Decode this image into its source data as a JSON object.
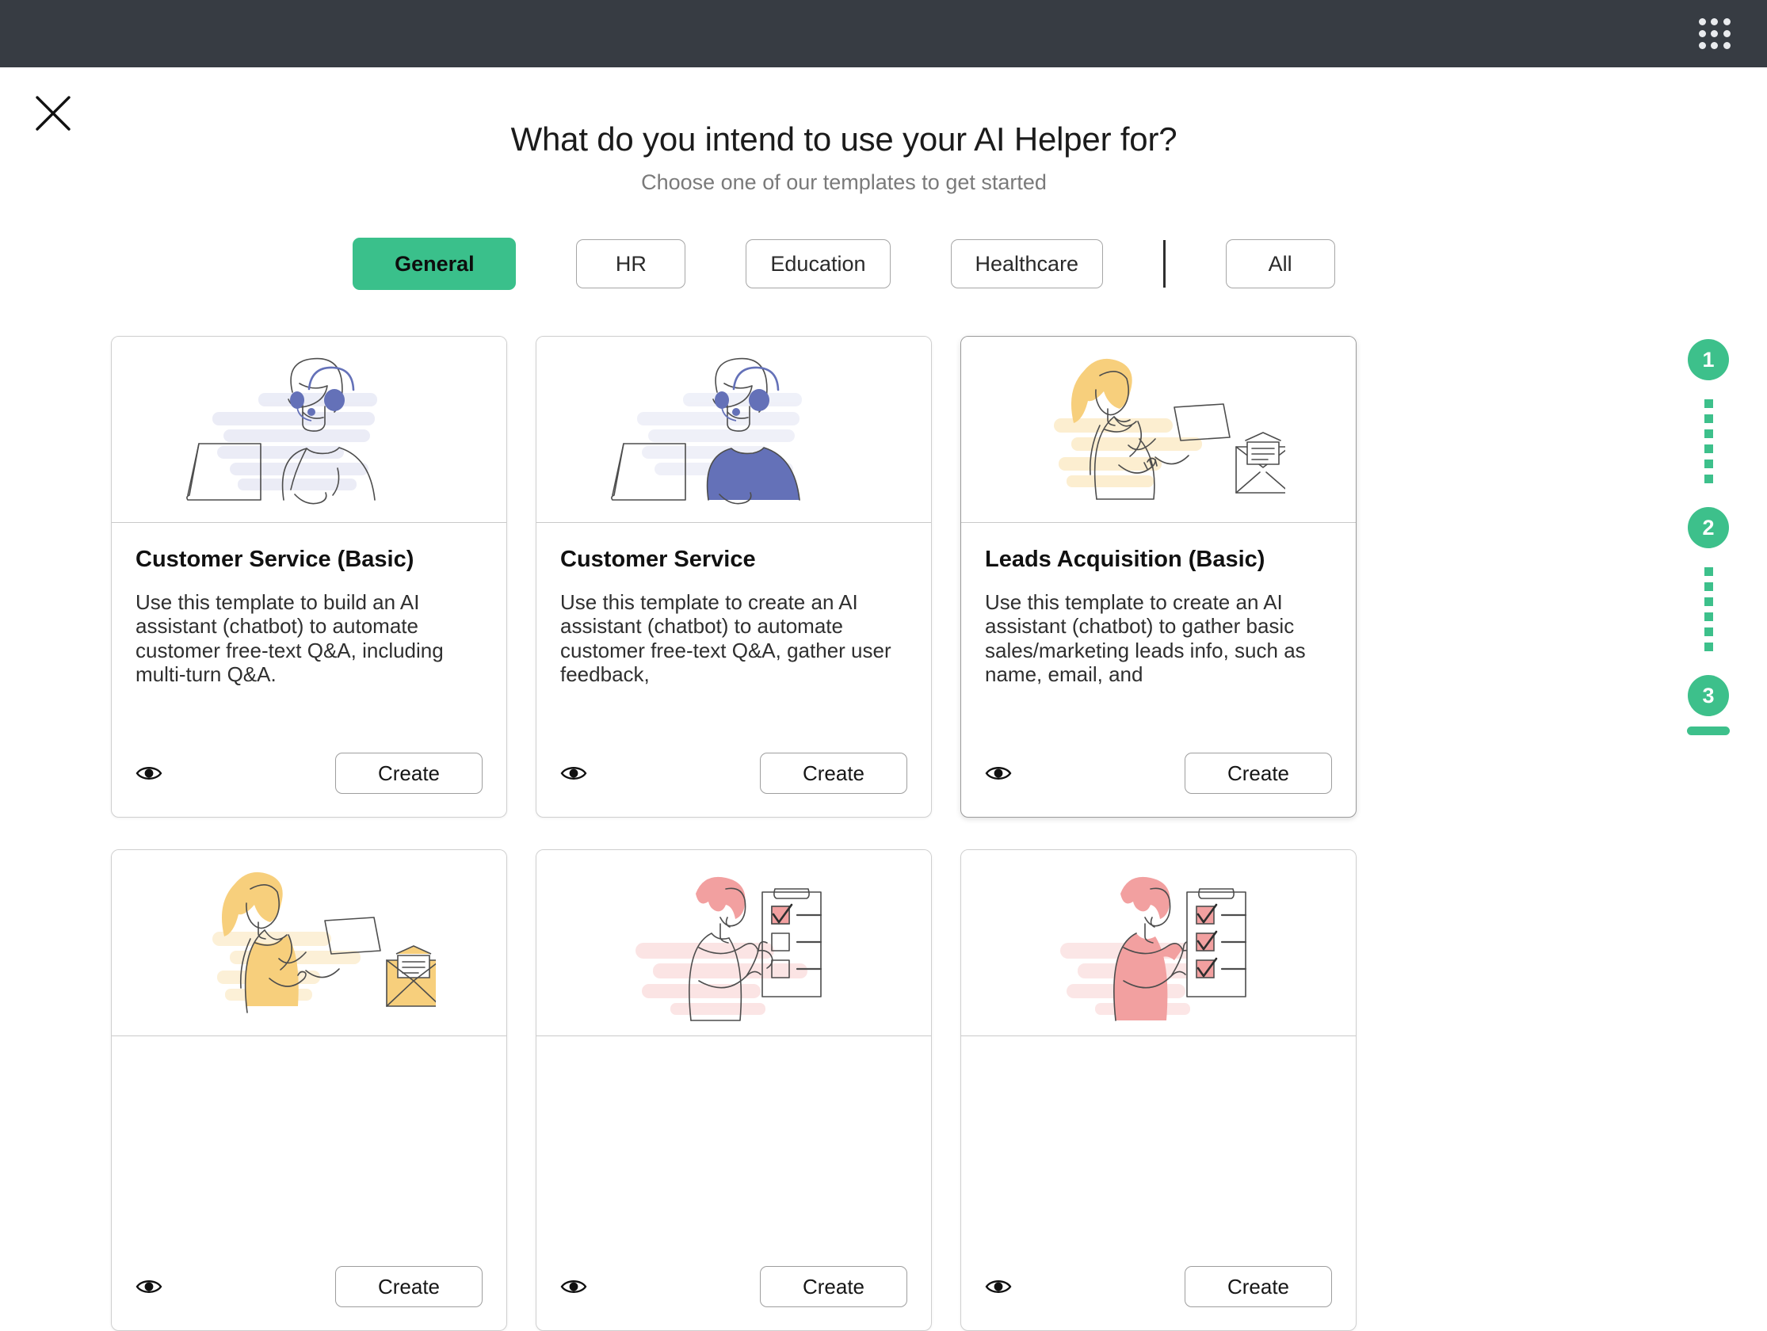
{
  "topbar": {
    "apps_icon": "grid-dots-icon"
  },
  "close_icon": "close-icon",
  "header": {
    "title": "What do you intend to use your AI Helper for?",
    "subtitle": "Choose one of our templates to get started"
  },
  "tabs": [
    {
      "label": "General",
      "active": true
    },
    {
      "label": "HR",
      "active": false
    },
    {
      "label": "Education",
      "active": false
    },
    {
      "label": "Healthcare",
      "active": false
    },
    {
      "label": "All",
      "active": false
    }
  ],
  "cards": [
    {
      "title": "Customer Service (Basic)",
      "description": "Use this template to build an AI assistant (chatbot) to automate customer free-text Q&A, including multi-turn Q&A.",
      "preview_icon": "eye-icon",
      "create_label": "Create",
      "illustration": "agent-headset-laptop-outline",
      "hovered": false
    },
    {
      "title": "Customer Service",
      "description": "Use this template to create an AI assistant (chatbot) to automate customer free-text Q&A, gather user feedback,",
      "preview_icon": "eye-icon",
      "create_label": "Create",
      "illustration": "agent-headset-laptop-filled",
      "hovered": false
    },
    {
      "title": "Leads Acquisition (Basic)",
      "description": "Use this template to create an AI assistant (chatbot) to gather basic sales/marketing leads info, such as name, email, and",
      "preview_icon": "eye-icon",
      "create_label": "Create",
      "illustration": "woman-paper-envelope-outline",
      "hovered": true
    },
    {
      "title": "",
      "description": "",
      "preview_icon": "eye-icon",
      "create_label": "Create",
      "illustration": "woman-paper-envelope-filled",
      "hovered": false
    },
    {
      "title": "",
      "description": "",
      "preview_icon": "eye-icon",
      "create_label": "Create",
      "illustration": "person-checklist-outline",
      "hovered": false
    },
    {
      "title": "",
      "description": "",
      "preview_icon": "eye-icon",
      "create_label": "Create",
      "illustration": "person-checklist-filled",
      "hovered": false
    }
  ],
  "stepper": {
    "steps": [
      "1",
      "2",
      "3"
    ],
    "current": "3"
  },
  "colors": {
    "accent_green": "#3dc08b",
    "topbar_dark": "#373c43",
    "illustration_purple": "#6471b8",
    "illustration_yellow": "#f7cf7c",
    "illustration_pink": "#f2a0a0",
    "line_gray": "#4d4d4d"
  }
}
